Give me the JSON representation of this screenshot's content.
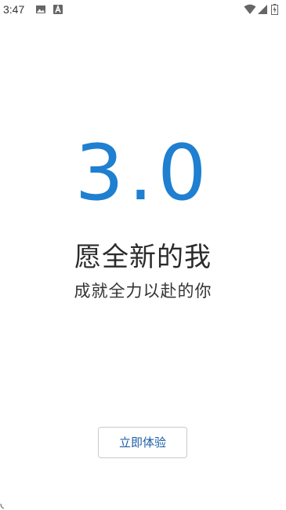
{
  "status_bar": {
    "time": "3:47",
    "icons": [
      "image-icon",
      "a-letter-icon",
      "wifi-icon",
      "signal-icon",
      "battery-icon"
    ]
  },
  "welcome": {
    "version": "3.0",
    "headline": "愿全新的我",
    "subline": "成就全力以赴的你",
    "button_label": "立即体验"
  },
  "colors": {
    "accent_blue": "#1f7fd0",
    "button_text": "#1d5ea8",
    "button_border": "#c7cbd1",
    "text_dark": "#2a2a2a"
  }
}
